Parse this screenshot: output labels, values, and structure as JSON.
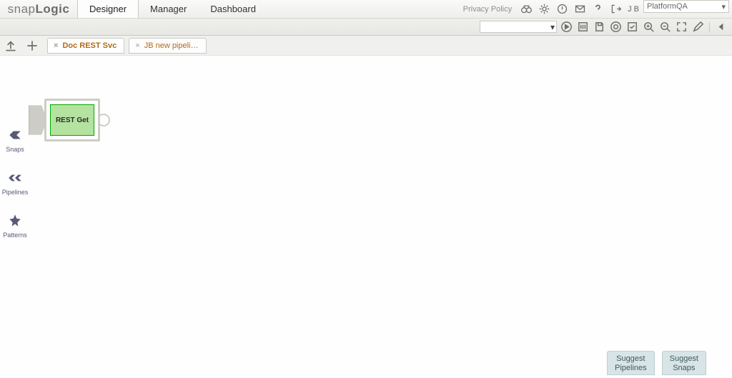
{
  "logo_plain": "snap",
  "logo_bold": "Logic",
  "menu": {
    "designer": "Designer",
    "manager": "Manager",
    "dashboard": "Dashboard"
  },
  "privacy_label": "Privacy Policy",
  "user_initials": "J B",
  "org_select": "PlatformQA",
  "tabs": [
    {
      "label": "Doc REST Svc",
      "active": true
    },
    {
      "label": "JB new pipeli…",
      "active": false
    }
  ],
  "sidebar": {
    "snaps": "Snaps",
    "pipelines": "Pipelines",
    "patterns": "Patterns"
  },
  "snap": {
    "label": "REST Get"
  },
  "suggest": {
    "pipelines_l1": "Suggest",
    "pipelines_l2": "Pipelines",
    "snaps_l1": "Suggest",
    "snaps_l2": "Snaps"
  }
}
